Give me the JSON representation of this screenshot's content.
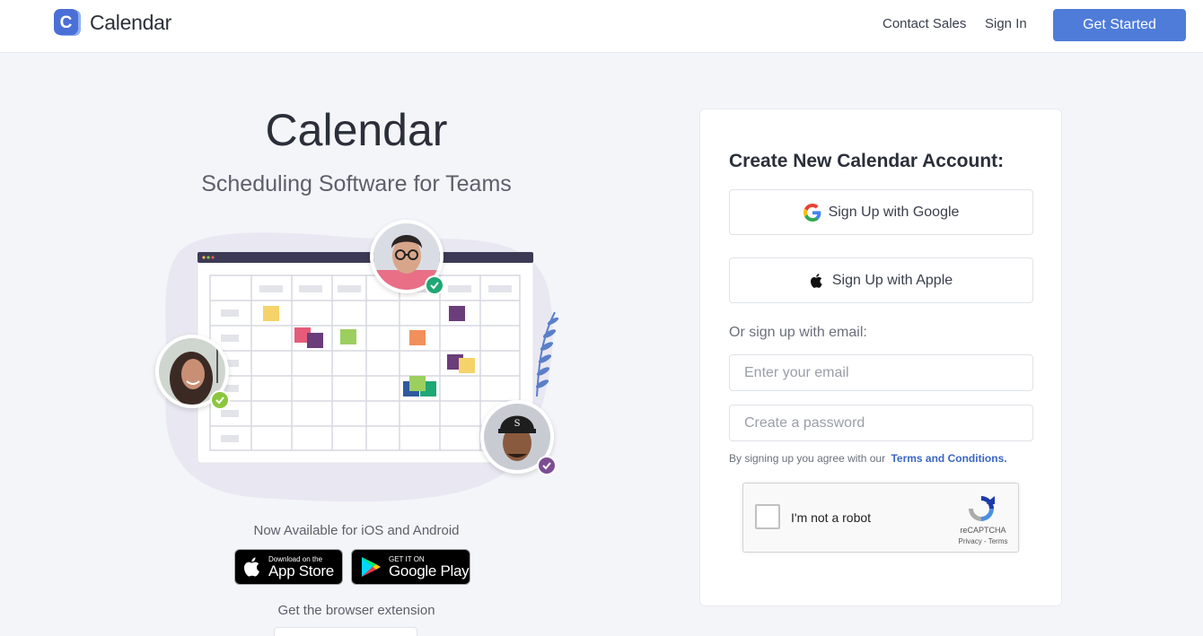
{
  "header": {
    "logo_text": "Calendar",
    "logo_letter": "C",
    "nav": {
      "contact_sales": "Contact Sales",
      "sign_in": "Sign In",
      "get_started": "Get Started"
    }
  },
  "hero": {
    "title": "Calendar",
    "subtitle": "Scheduling Software for Teams",
    "available_text": "Now Available for iOS and Android",
    "app_store": {
      "small": "Download on the",
      "big": "App Store"
    },
    "google_play": {
      "small": "GET IT ON",
      "big": "Google Play"
    },
    "extension_text": "Get the browser extension"
  },
  "signup": {
    "title": "Create New Calendar Account:",
    "google_button": "Sign Up with Google",
    "apple_button": "Sign Up with Apple",
    "or_email": "Or sign up with email:",
    "email_placeholder": "Enter your email",
    "password_placeholder": "Create a password",
    "terms_prefix": "By signing up you agree with our",
    "terms_link": "Terms and Conditions.",
    "recaptcha": {
      "label": "I'm not a robot",
      "brand": "reCAPTCHA",
      "privacy": "Privacy",
      "separator": " - ",
      "terms": "Terms"
    }
  },
  "colors": {
    "primary": "#4f7cd8",
    "logo_blue": "#4a6fd6",
    "check_green": "#1fa776",
    "check_lime": "#8cc63f",
    "check_purple": "#7c4d93",
    "link": "#3a66c4"
  },
  "icons": {
    "logo": "calendar-logo-icon",
    "google": "google-g-icon",
    "apple": "apple-icon",
    "play": "google-play-icon",
    "recaptcha": "recaptcha-icon",
    "check": "check-icon"
  }
}
